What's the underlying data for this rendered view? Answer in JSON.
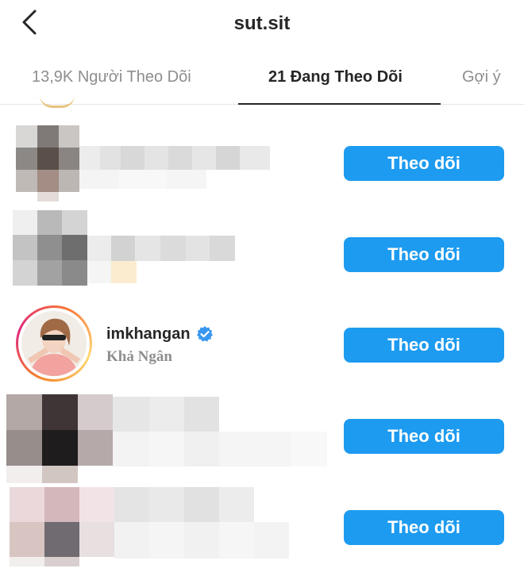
{
  "header": {
    "title": "sut.sit",
    "back_icon": "chevron-left-icon"
  },
  "tabs": [
    {
      "label": "13,9K Người Theo Dõi",
      "active": false
    },
    {
      "label": "21 Đang Theo Dõi",
      "active": true
    },
    {
      "label": "Gợi ý",
      "active": false
    }
  ],
  "accounts": [
    {
      "username": "",
      "full_name": "",
      "blurred": true,
      "button_label": "Theo dõi"
    },
    {
      "username": "",
      "full_name": "",
      "blurred": true,
      "button_label": "Theo dõi"
    },
    {
      "username": "imkhangan",
      "full_name": "Khả Ngân",
      "verified": true,
      "has_story": true,
      "blurred": false,
      "button_label": "Theo dõi"
    },
    {
      "username": "",
      "full_name": "",
      "blurred": true,
      "button_label": "Theo dõi"
    },
    {
      "username": "",
      "full_name": "",
      "blurred": true,
      "button_label": "Theo dõi"
    }
  ],
  "colors": {
    "follow_button": "#1d9bf0",
    "verified_badge": "#3897f0",
    "primary_text": "#262626",
    "secondary_text": "#8e8e8e"
  }
}
